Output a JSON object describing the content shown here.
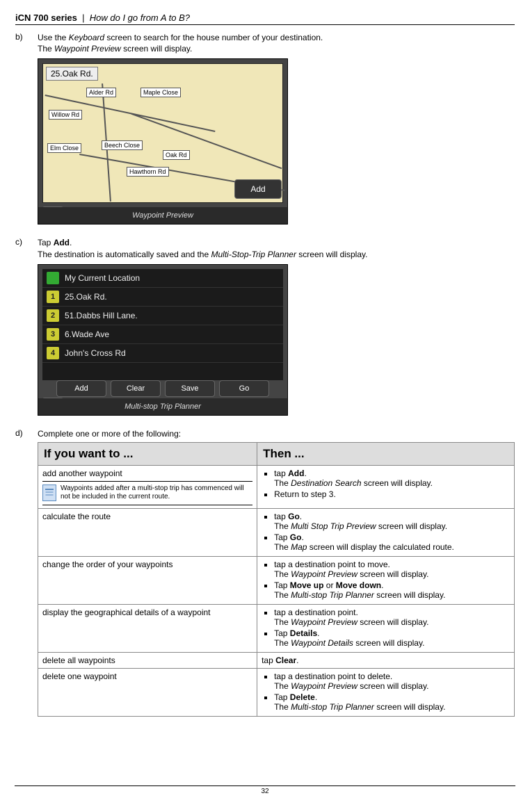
{
  "header": {
    "series": "iCN 700 series",
    "sep": "|",
    "chapter": "How do I go from A to B?"
  },
  "step_b": {
    "letter": "b)",
    "line1_a": "Use the ",
    "line1_b": "Keyboard",
    "line1_c": " screen to search for the house number of your destination.",
    "line2_a": "The ",
    "line2_b": "Waypoint Preview",
    "line2_c": " screen will display."
  },
  "shot1": {
    "address": "25.Oak Rd.",
    "labels": {
      "alder": "Alder Rd",
      "maple": "Maple Close",
      "willow": "Willow Rd",
      "elm": "Elm Close",
      "beech": "Beech Close",
      "oak": "Oak Rd",
      "hawthorn": "Hawthorn Rd"
    },
    "add_btn": "Add",
    "footer": "Waypoint Preview",
    "back": "<"
  },
  "step_c": {
    "letter": "c)",
    "line1_a": "Tap ",
    "line1_b": "Add",
    "line1_c": ".",
    "line2_a": "The destination is automatically saved and the ",
    "line2_b": "Multi-Stop-Trip Planner",
    "line2_c": " screen will display."
  },
  "shot2": {
    "rows": [
      {
        "flag_type": "green",
        "flag_text": "",
        "label": "My Current Location"
      },
      {
        "flag_type": "num",
        "flag_text": "1",
        "label": "25.Oak Rd."
      },
      {
        "flag_type": "num",
        "flag_text": "2",
        "label": "51.Dabbs Hill Lane."
      },
      {
        "flag_type": "num",
        "flag_text": "3",
        "label": "6.Wade Ave"
      },
      {
        "flag_type": "num",
        "flag_text": "4",
        "label": "John's Cross Rd"
      }
    ],
    "buttons": [
      "Add",
      "Clear",
      "Save",
      "Go"
    ],
    "footer": "Multi-stop Trip Planner",
    "back": "<"
  },
  "step_d": {
    "letter": "d)",
    "text": "Complete one or more of the following:"
  },
  "table": {
    "h1": "If you want to ...",
    "h2": "Then ...",
    "rows": [
      {
        "want_main": "add another waypoint",
        "note": "Waypoints added after a multi-stop trip has commenced will not be included in the current route.",
        "then": [
          {
            "pre": "tap ",
            "bold": "Add",
            "post": ".",
            "sub_a": "The ",
            "sub_i": "Destination Search",
            "sub_b": " screen will display."
          },
          {
            "pre": "Return to step 3.",
            "bold": "",
            "post": ""
          }
        ]
      },
      {
        "want_main": "calculate the route",
        "then": [
          {
            "pre": "tap ",
            "bold": "Go",
            "post": ".",
            "sub_a": "The ",
            "sub_i": "Multi Stop Trip Preview",
            "sub_b": " screen will display."
          },
          {
            "pre": "Tap ",
            "bold": "Go",
            "post": ".",
            "sub_a": "The ",
            "sub_i": "Map",
            "sub_b": " screen will display the calculated route."
          }
        ]
      },
      {
        "want_main": "change the order of your waypoints",
        "then": [
          {
            "pre": "tap a destination point to move.",
            "bold": "",
            "post": "",
            "sub_a": "The ",
            "sub_i": "Waypoint Preview",
            "sub_b": " screen will display."
          },
          {
            "pre": "Tap ",
            "bold": "Move up",
            "mid": " or ",
            "bold2": "Move down",
            "post": ".",
            "sub_a": "The ",
            "sub_i": "Multi-stop Trip Planner",
            "sub_b": " screen will display."
          }
        ]
      },
      {
        "want_main": "display the geographical details of a waypoint",
        "then": [
          {
            "pre": "tap a destination point.",
            "bold": "",
            "post": "",
            "sub_a": "The ",
            "sub_i": "Waypoint Preview",
            "sub_b": " screen will display."
          },
          {
            "pre": "Tap ",
            "bold": "Details",
            "post": ".",
            "sub_a": "The ",
            "sub_i": "Waypoint Details",
            "sub_b": " screen will display."
          }
        ]
      },
      {
        "want_main": "delete all waypoints",
        "then_plain_a": "tap ",
        "then_plain_b": "Clear",
        "then_plain_c": "."
      },
      {
        "want_main": "delete one waypoint",
        "then": [
          {
            "pre": "tap a destination point to delete.",
            "bold": "",
            "post": "",
            "sub_a": "The ",
            "sub_i": "Waypoint Preview",
            "sub_b": " screen will display."
          },
          {
            "pre": "Tap ",
            "bold": "Delete",
            "post": ".",
            "sub_a": "The ",
            "sub_i": "Multi-stop Trip Planner",
            "sub_b": " screen will display."
          }
        ]
      }
    ]
  },
  "page_num": "32"
}
